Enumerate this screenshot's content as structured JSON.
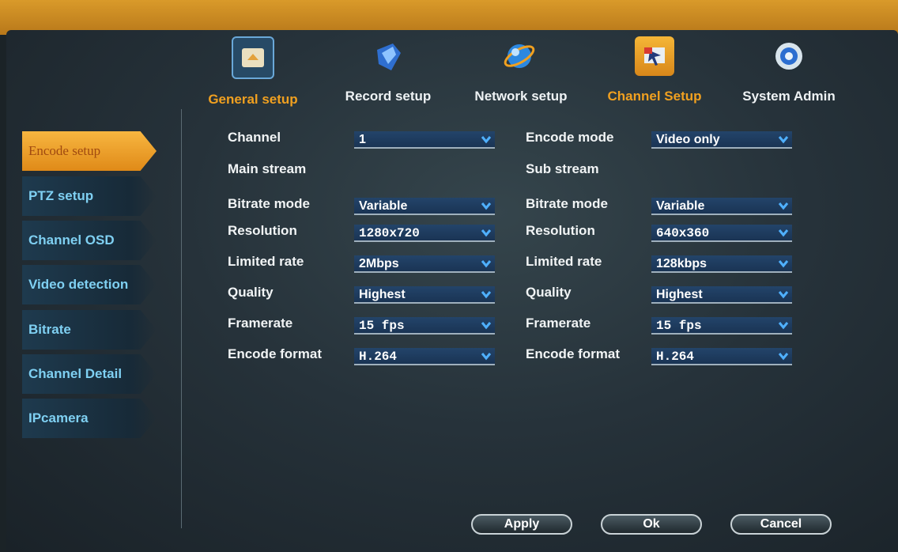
{
  "nav": [
    {
      "label": "General setup",
      "icon": "general-setup-icon"
    },
    {
      "label": "Record setup",
      "icon": "record-setup-icon"
    },
    {
      "label": "Network setup",
      "icon": "network-setup-icon"
    },
    {
      "label": "Channel Setup",
      "icon": "channel-setup-icon"
    },
    {
      "label": "System Admin",
      "icon": "system-admin-icon"
    }
  ],
  "sidebar": [
    {
      "label": "Encode setup"
    },
    {
      "label": "PTZ setup"
    },
    {
      "label": "Channel OSD"
    },
    {
      "label": "Video detection"
    },
    {
      "label": "Bitrate"
    },
    {
      "label": "Channel Detail"
    },
    {
      "label": "IPcamera"
    }
  ],
  "top": {
    "channel_label": "Channel",
    "channel_value": "1",
    "encode_mode_label": "Encode mode",
    "encode_mode_value": "Video only"
  },
  "main": {
    "heading": "Main stream",
    "fields": [
      {
        "label": "Bitrate mode",
        "value": "Variable"
      },
      {
        "label": "Resolution",
        "value": "1280x720"
      },
      {
        "label": "Limited rate",
        "value": "2Mbps"
      },
      {
        "label": "Quality",
        "value": "Highest"
      },
      {
        "label": "Framerate",
        "value": "15 fps"
      },
      {
        "label": "Encode format",
        "value": "H.264"
      }
    ]
  },
  "sub": {
    "heading": "Sub stream",
    "fields": [
      {
        "label": "Bitrate mode",
        "value": "Variable"
      },
      {
        "label": "Resolution",
        "value": "640x360"
      },
      {
        "label": "Limited rate",
        "value": "128kbps"
      },
      {
        "label": "Quality",
        "value": "Highest"
      },
      {
        "label": "Framerate",
        "value": "15 fps"
      },
      {
        "label": "Encode format",
        "value": "H.264"
      }
    ]
  },
  "buttons": {
    "apply": "Apply",
    "ok": "Ok",
    "cancel": "Cancel"
  },
  "colors": {
    "accent": "#f0a020",
    "tab_text": "#7fd0f2",
    "dropdown_bg": "#1a3454"
  }
}
